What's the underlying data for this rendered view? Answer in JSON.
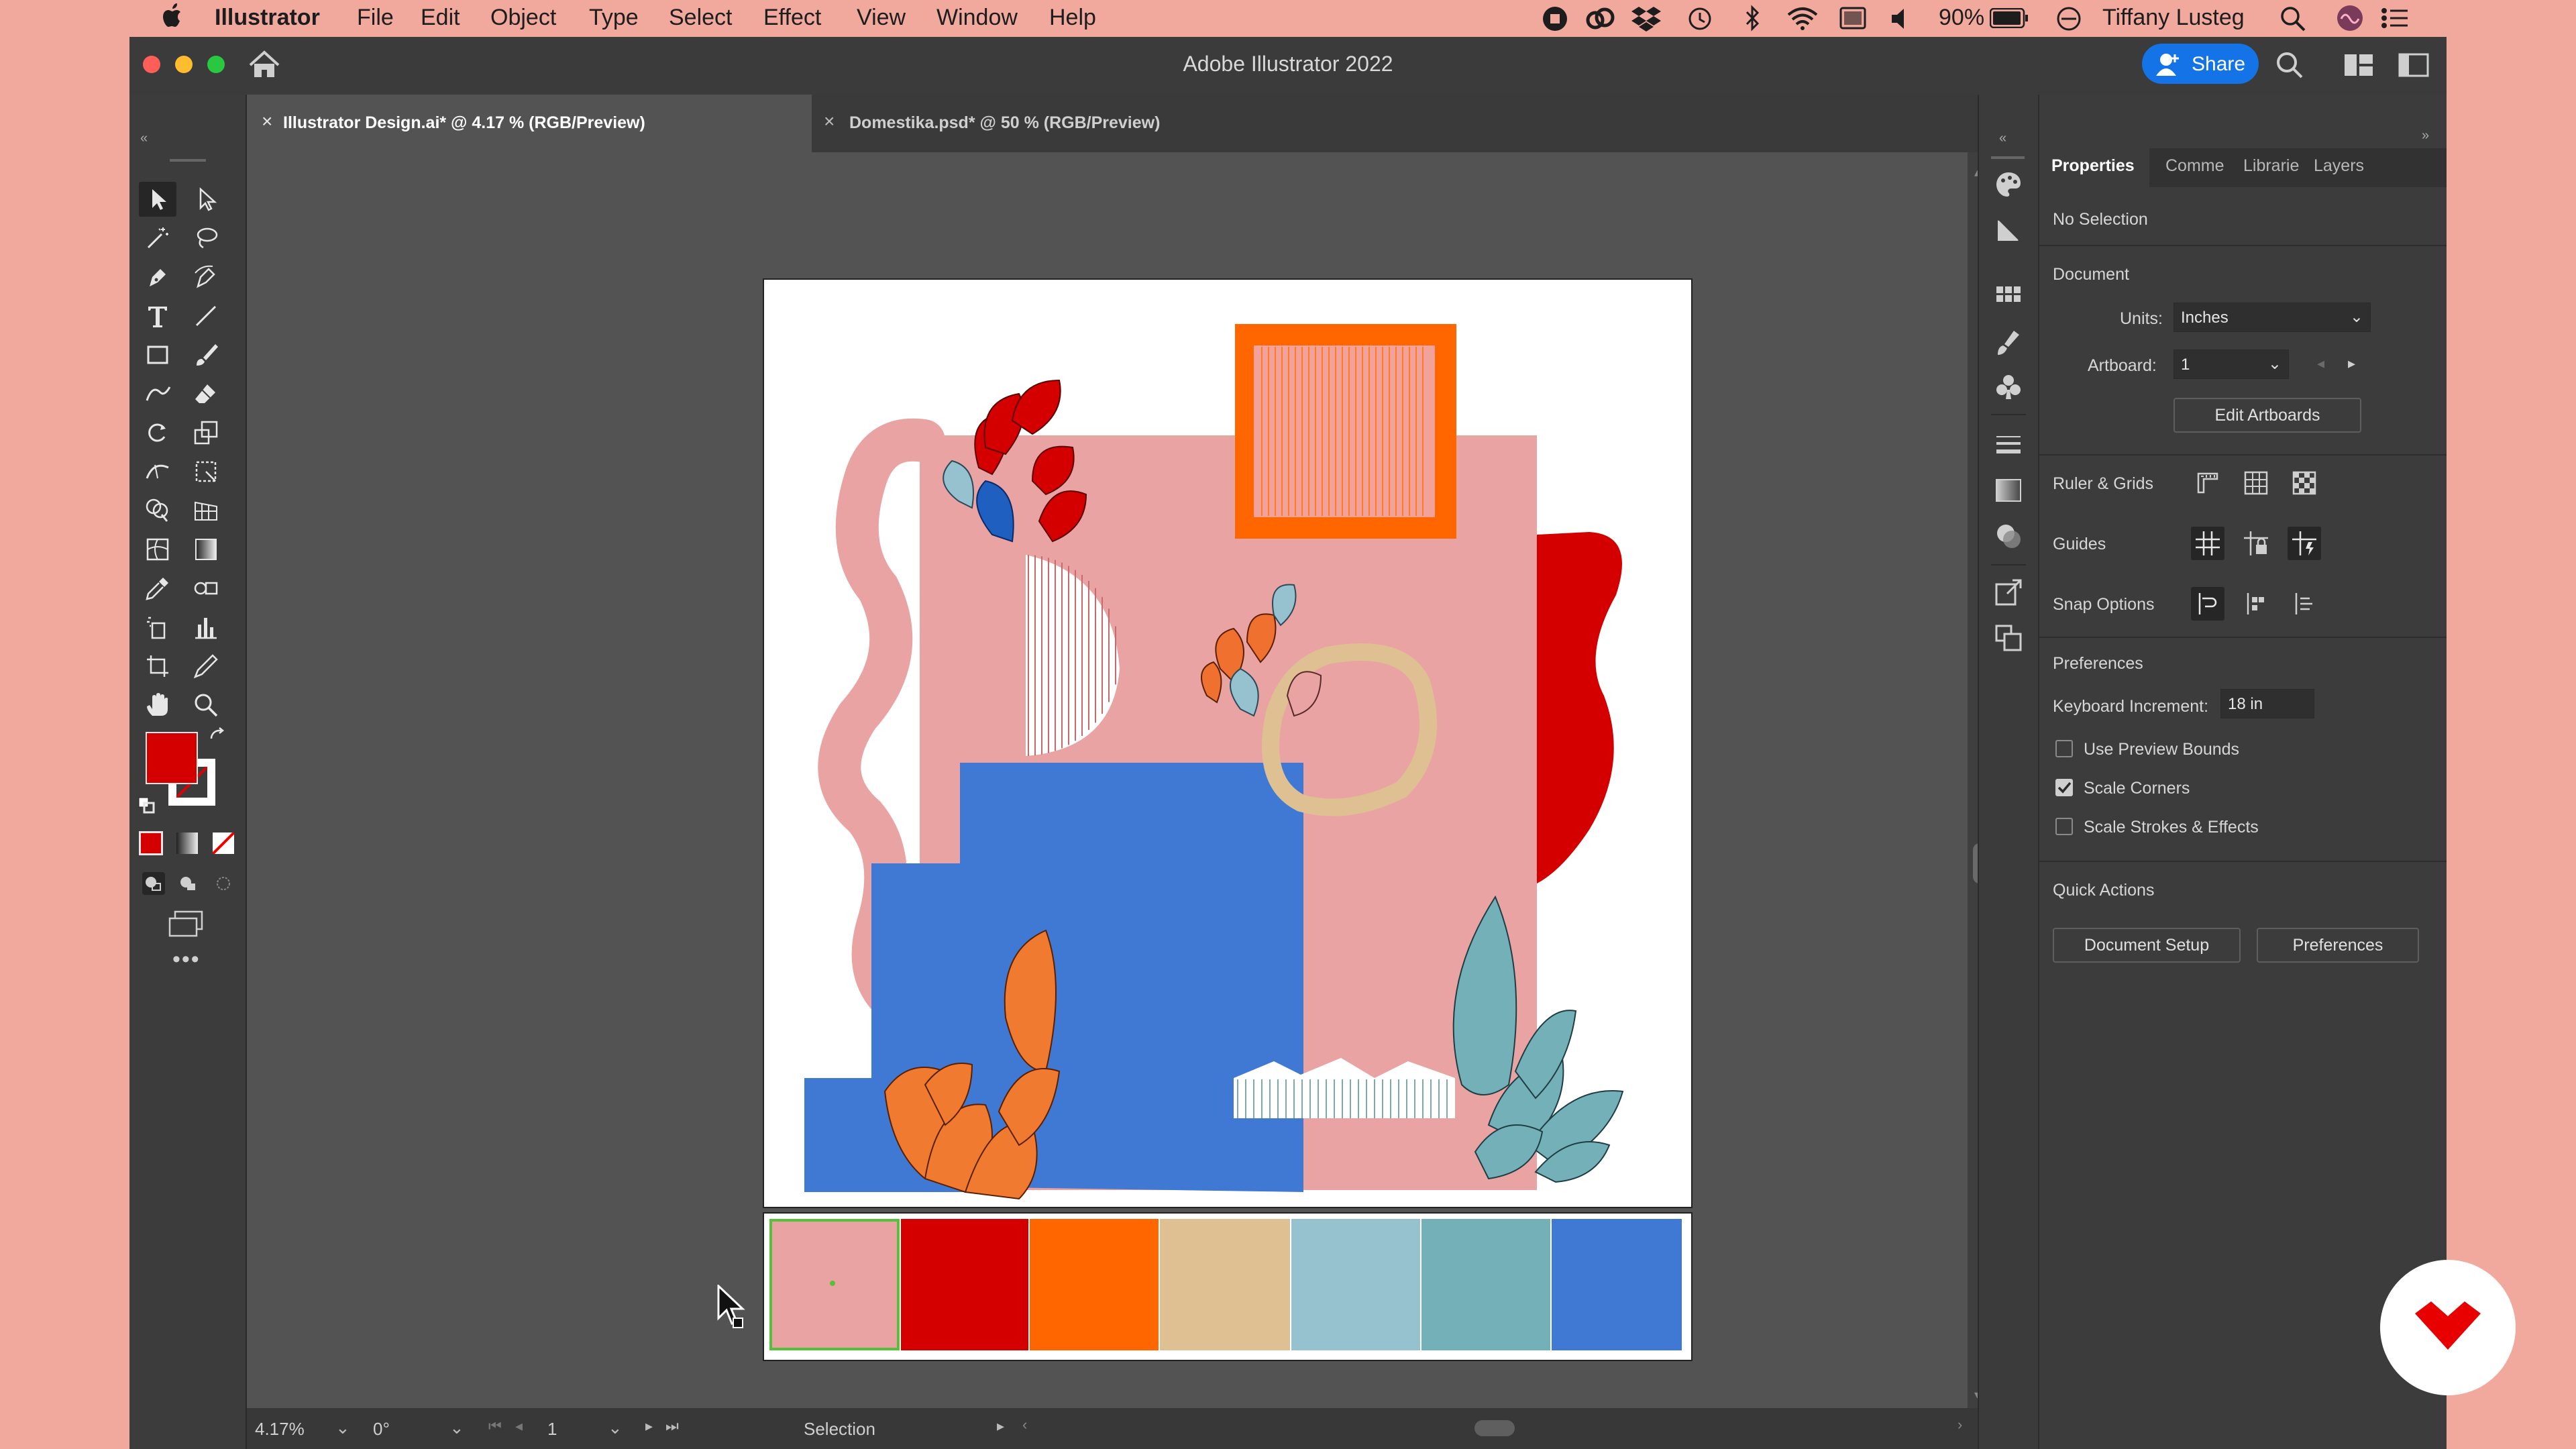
{
  "menubar": {
    "app_name": "Illustrator",
    "items": [
      "File",
      "Edit",
      "Object",
      "Type",
      "Select",
      "Effect",
      "View",
      "Window",
      "Help"
    ],
    "battery": "90%",
    "user": "Tiffany Lusteg"
  },
  "window": {
    "title": "Adobe Illustrator 2022",
    "share_label": "Share"
  },
  "tabs": [
    {
      "label": "Illustrator Design.ai* @ 4.17 % (RGB/Preview)",
      "active": true
    },
    {
      "label": "Domestika.psd* @ 50 % (RGB/Preview)",
      "active": false
    }
  ],
  "colors": {
    "fill": "#d40000",
    "swatches": [
      "#e9a3a3",
      "#d40000",
      "#ff6600",
      "#dfc093",
      "#96c1cf",
      "#74b0b8",
      "#3f79d4"
    ]
  },
  "panel": {
    "tabs": [
      "Properties",
      "Comme",
      "Librarie",
      "Layers"
    ],
    "selection": "No Selection",
    "document_heading": "Document",
    "units_label": "Units:",
    "units_value": "Inches",
    "artboard_label": "Artboard:",
    "artboard_value": "1",
    "edit_artboards": "Edit Artboards",
    "ruler_grids": "Ruler & Grids",
    "guides": "Guides",
    "snap_options": "Snap Options",
    "preferences_heading": "Preferences",
    "keyboard_increment_label": "Keyboard Increment:",
    "keyboard_increment_value": "18 in",
    "use_preview_bounds": "Use Preview Bounds",
    "scale_corners": "Scale Corners",
    "scale_strokes": "Scale Strokes & Effects",
    "quick_actions": "Quick Actions",
    "document_setup": "Document Setup",
    "preferences_button": "Preferences"
  },
  "status": {
    "zoom": "4.17%",
    "rotation": "0°",
    "artboard": "1",
    "tool": "Selection"
  }
}
